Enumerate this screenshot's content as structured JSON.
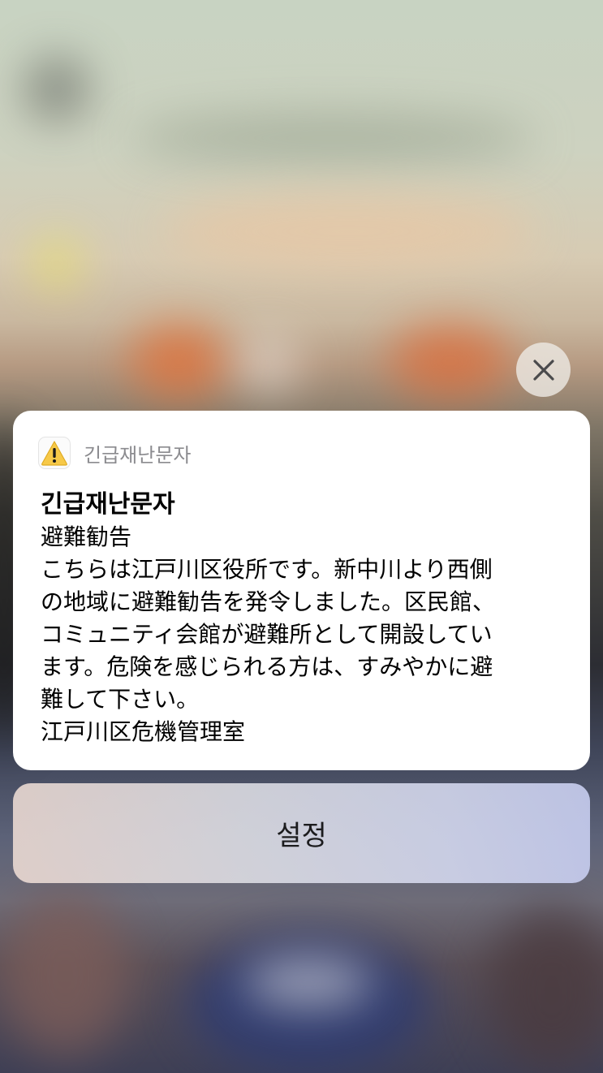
{
  "notification": {
    "app_name": "긴급재난문자",
    "app_icon": "warning-triangle-icon",
    "title": "긴급재난문자",
    "subtitle": "避難勧告",
    "body": "こちらは江戸川区役所です。新中川より西側\nの地域に避難勧告を発令しました。区民館、\nコミュニティ会館が避難所として開設してい\nます。危険を感じられる方は、すみやかに避\n難して下さい。",
    "signature": "江戸川区危機管理室"
  },
  "close_button": {
    "icon": "close-icon"
  },
  "settings_button": {
    "label": "설정"
  },
  "colors": {
    "warning_yellow": "#f7c948",
    "card_bg": "#ffffff",
    "secondary_text": "#8b8b8f"
  }
}
